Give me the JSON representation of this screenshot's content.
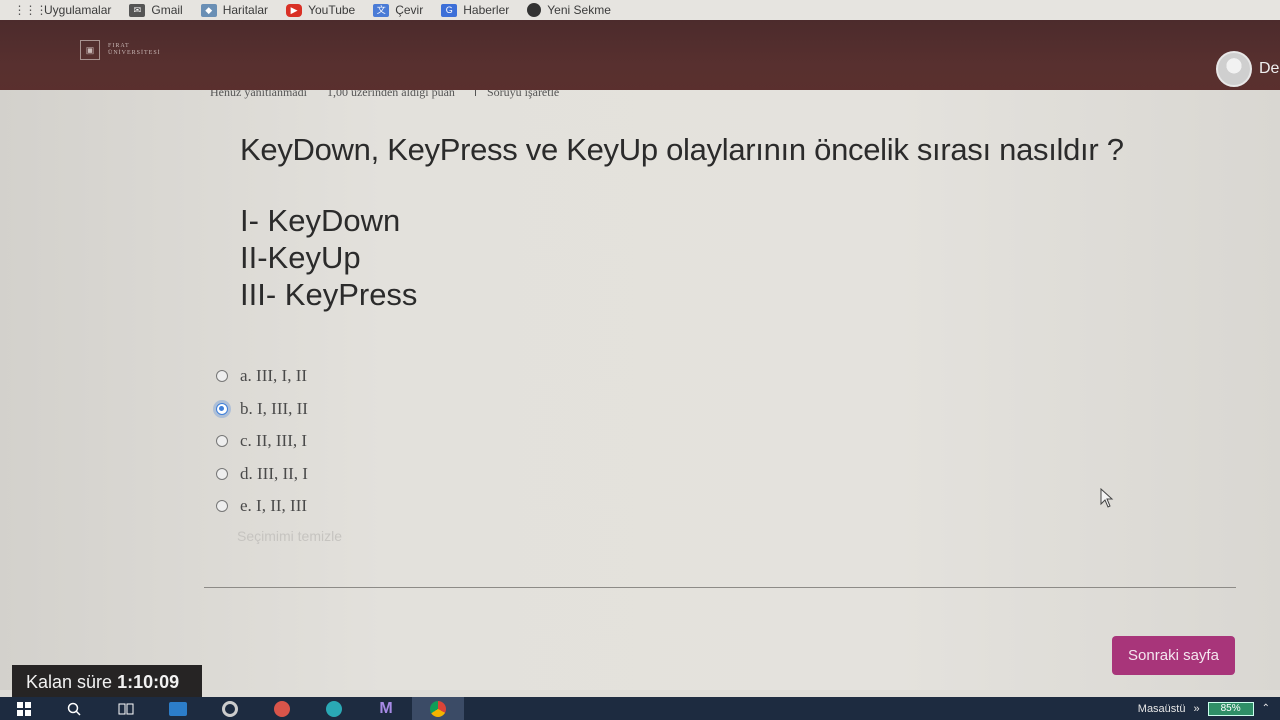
{
  "bookmarks": [
    {
      "label": "Uygulamalar",
      "icon": "apps-grid-icon"
    },
    {
      "label": "Gmail",
      "icon": "gmail-icon"
    },
    {
      "label": "Haritalar",
      "icon": "maps-icon"
    },
    {
      "label": "YouTube",
      "icon": "youtube-icon"
    },
    {
      "label": "Çevir",
      "icon": "translate-icon"
    },
    {
      "label": "Haberler",
      "icon": "news-icon"
    },
    {
      "label": "Yeni Sekme",
      "icon": "globe-icon"
    }
  ],
  "header": {
    "logo_line1": "FIRAT",
    "logo_line2": "ÜNİVERSİTESİ",
    "user_name": "De",
    "background_color": "#58302f"
  },
  "question_info": {
    "status": "Henüz yanıtlanmadı",
    "points": "1,00 üzerinden aldığı puan",
    "flag_label": "Soruyu işaretle"
  },
  "question": {
    "text": "KeyDown, KeyPress ve KeyUp olaylarının öncelik sırası nasıldır ?",
    "items": [
      "I- KeyDown",
      "II-KeyUp",
      "III- KeyPress"
    ]
  },
  "answers": [
    {
      "label": "a. III, I, II",
      "selected": false
    },
    {
      "label": "b. I, III, II",
      "selected": true
    },
    {
      "label": "c. II, III, I",
      "selected": false
    },
    {
      "label": "d. III, II, I",
      "selected": false
    },
    {
      "label": "e. I, II, III",
      "selected": false
    }
  ],
  "clear_choice": "Seçimimi temizle",
  "next_button": {
    "label": "Sonraki sayfa",
    "color": "#a8357a"
  },
  "timer": {
    "label": "Kalan süre",
    "value": "1:10:09"
  },
  "taskbar": {
    "desktop_label": "Masaüstü",
    "battery": "85%",
    "chevron": "»"
  }
}
